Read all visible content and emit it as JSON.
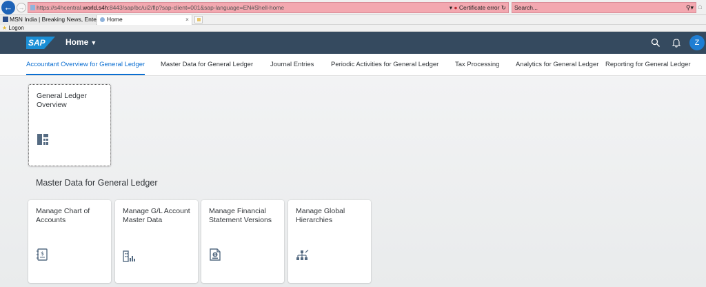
{
  "browser": {
    "url_prefix": "https://s4hcentral.",
    "url_domain": "world.s4h",
    "url_rest": ":8443/sap/bc/ui2/flp?sap-client=001&sap-language=EN#Shell-home",
    "cert_error": "Certificate error",
    "search_placeholder": "Search...",
    "tabs": [
      {
        "label": "MSN India | Breaking News, Ente..."
      },
      {
        "label": "Home"
      }
    ],
    "favorites_item": "Logon"
  },
  "shell": {
    "logo_text": "SAP",
    "title": "Home",
    "avatar_initial": "Z"
  },
  "anchor_tabs": [
    {
      "label": "Accountant Overview for General Ledger",
      "active": true
    },
    {
      "label": "Master Data for General Ledger"
    },
    {
      "label": "Journal Entries"
    },
    {
      "label": "Periodic Activities for General Ledger"
    },
    {
      "label": "Tax Processing"
    },
    {
      "label": "Analytics for General Ledger"
    },
    {
      "label": "Reporting for General Ledger"
    }
  ],
  "sections": {
    "master_data_title": "Master Data for General Ledger"
  },
  "tiles": {
    "overview": {
      "title": "General Ledger Overview",
      "icon": "overview-icon"
    },
    "chart_of_accounts": {
      "title": "Manage Chart of Accounts",
      "icon": "ledger-book-icon"
    },
    "gl_account": {
      "title": "Manage G/L Account Master Data",
      "icon": "building-chart-icon"
    },
    "financial_statement": {
      "title": "Manage Financial Statement Versions",
      "icon": "document-money-icon"
    },
    "global_hierarchies": {
      "title": "Manage Global Hierarchies",
      "icon": "hierarchy-icon"
    }
  },
  "colors": {
    "shell_bg": "#354a5f",
    "accent": "#0a6ed1",
    "icon": "#556b82"
  }
}
